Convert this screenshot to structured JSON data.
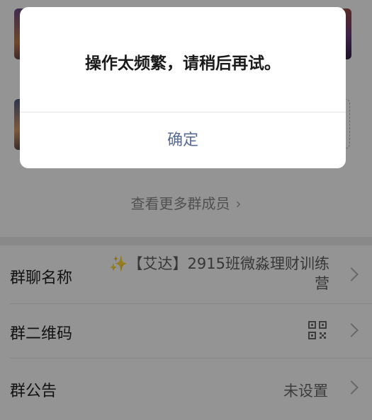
{
  "members": {
    "more_members_label": "查看更多群成员"
  },
  "settings": {
    "group_name_label": "群聊名称",
    "group_name_value": "✨【艾达】2915班微淼理财训练营",
    "qr_code_label": "群二维码",
    "announcement_label": "群公告",
    "announcement_value": "未设置"
  },
  "dialog": {
    "message": "操作太频繁，请稍后再试。",
    "confirm_label": "确定"
  },
  "colors": {
    "link_blue": "#576b95",
    "overlay": "rgba(0,0,0,0.42)"
  },
  "icons": {
    "chevron": "chevron-right-icon",
    "qr": "qr-code-icon"
  }
}
